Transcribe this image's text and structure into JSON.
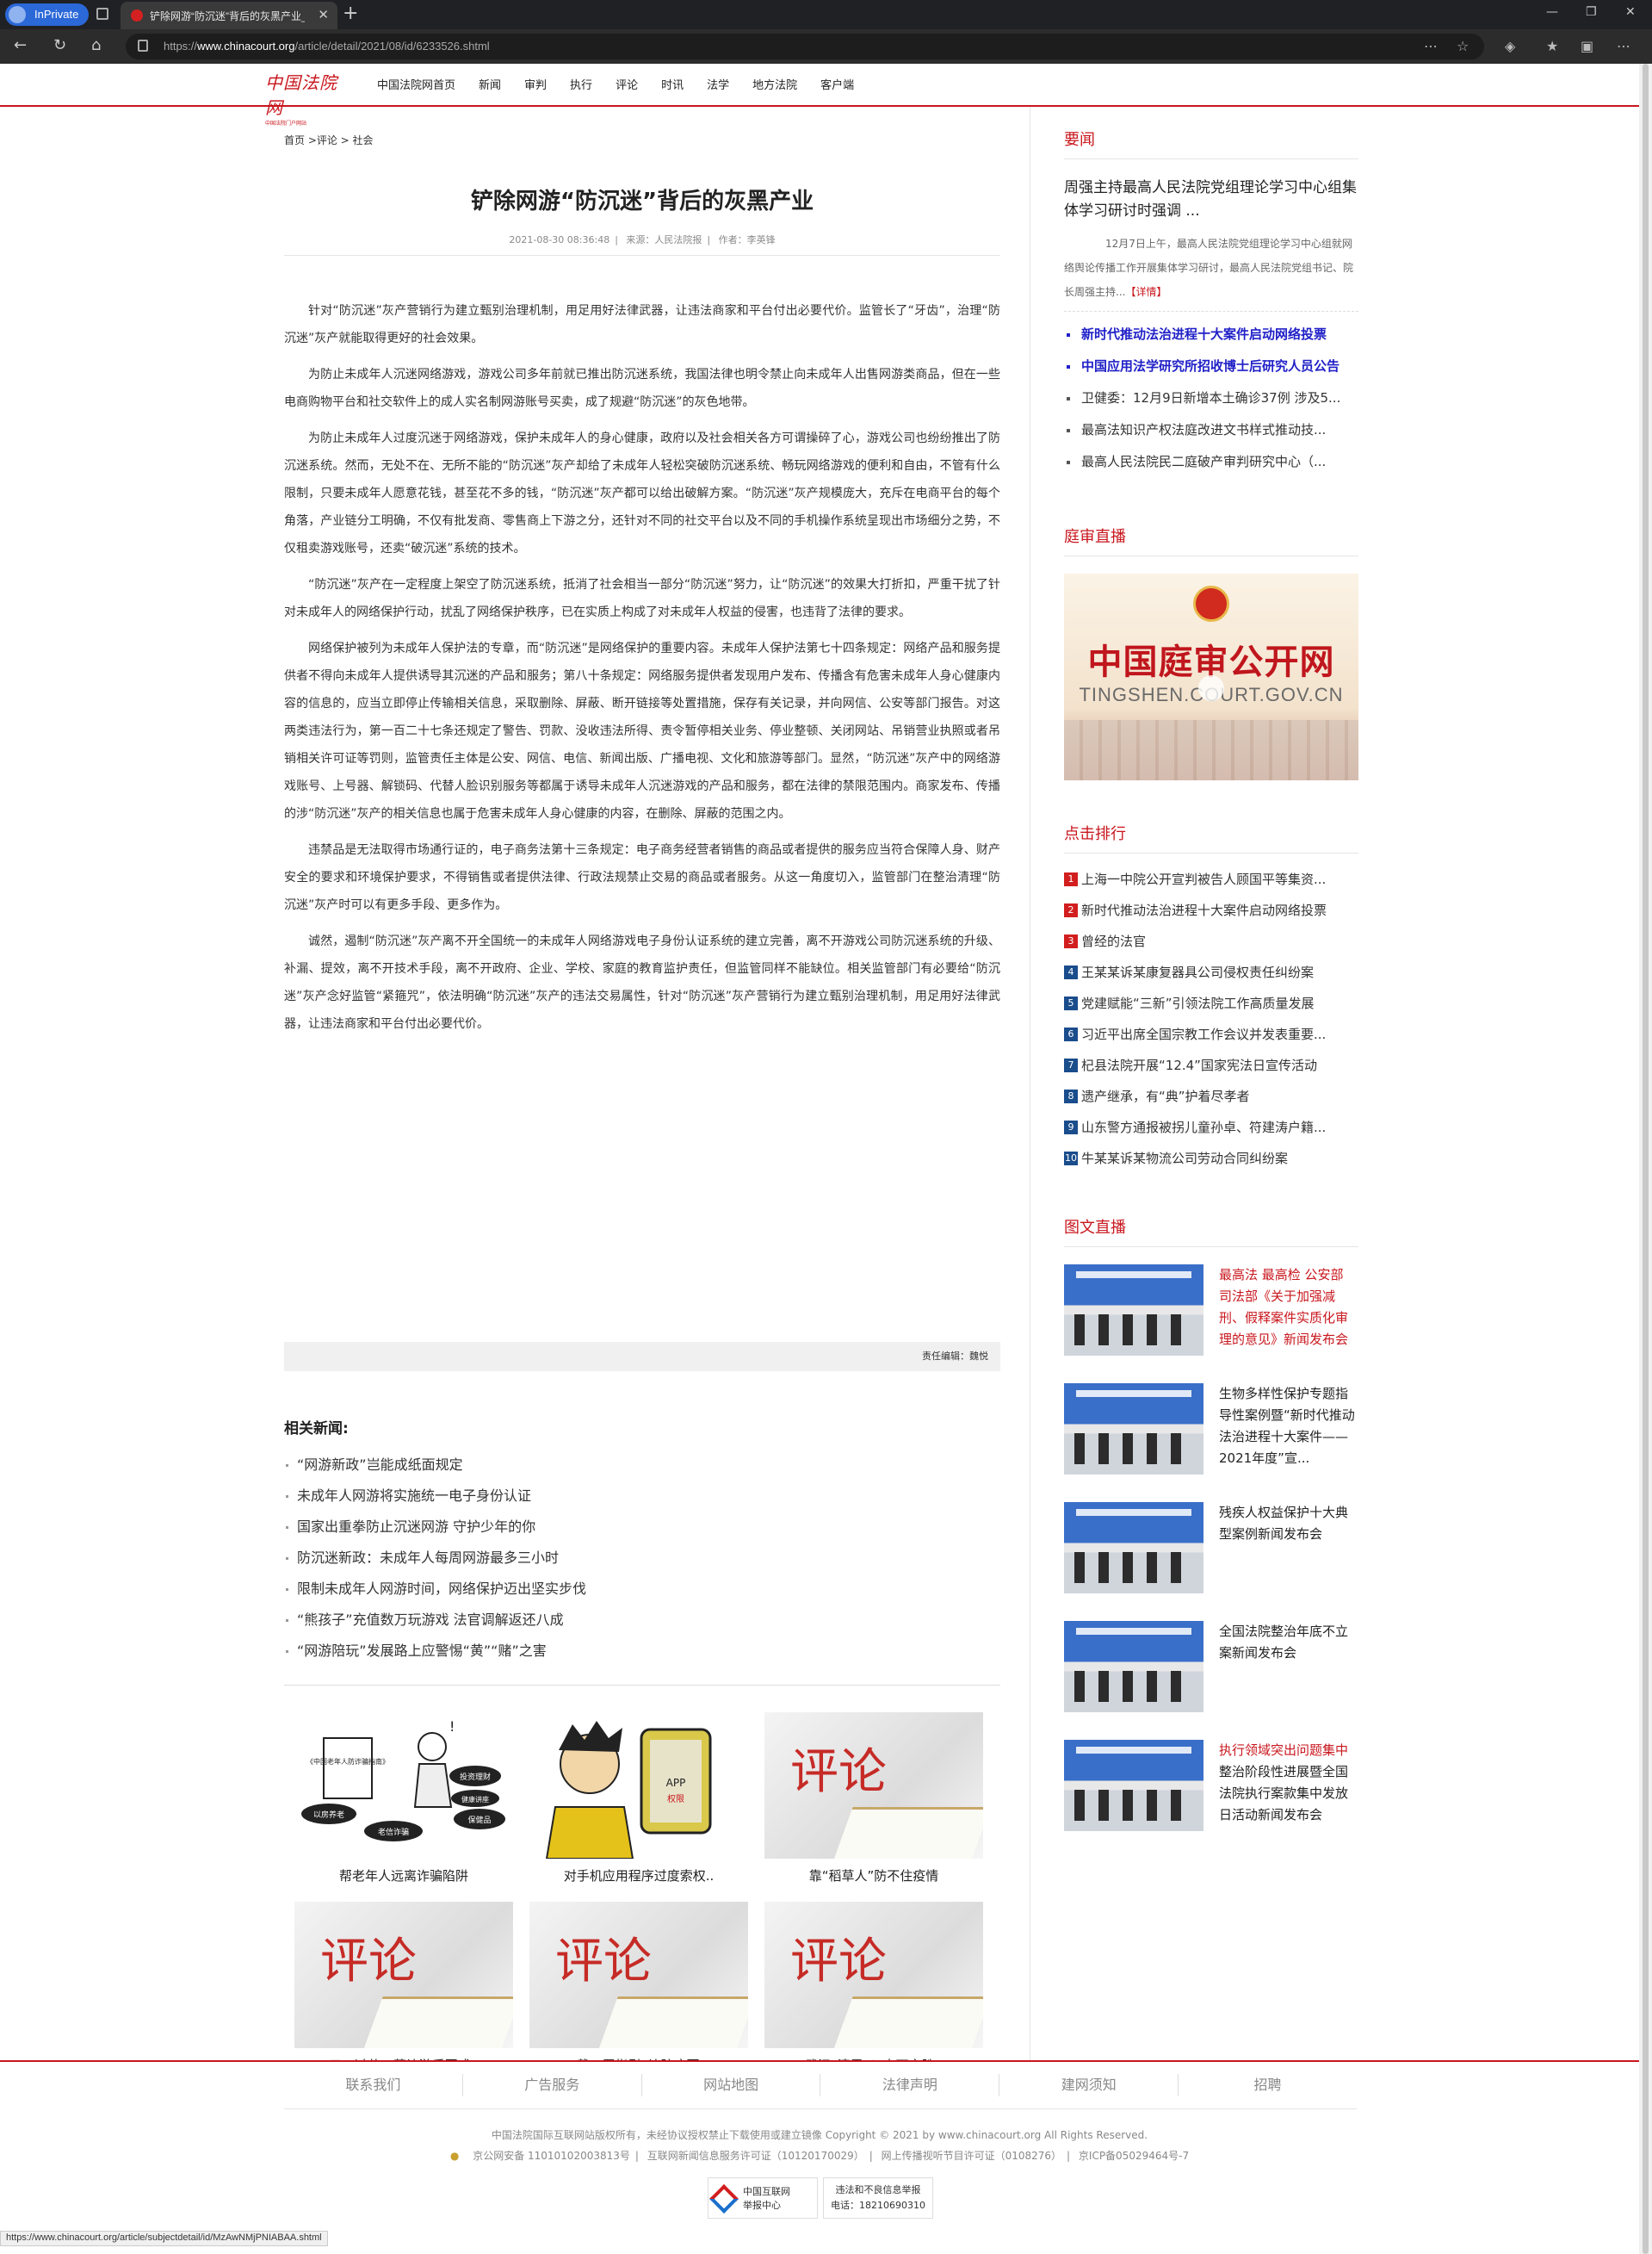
{
  "browser": {
    "inprivate_label": "InPrivate",
    "tab_title": "铲除网游“防沉迷”背后的灰黑产业_",
    "url_prefix": "https://",
    "url_domain": "www.chinacourt.org",
    "url_path": "/article/detail/2021/08/id/6233526.shtml",
    "status_url": "https://www.chinacourt.org/article/subjectdetail/id/MzAwNMjPNIABAA.shtml"
  },
  "header": {
    "logo_text": "中国法院网",
    "logo_sub": "中国法院门户网站",
    "nav": [
      "中国法院网首页",
      "新闻",
      "审判",
      "执行",
      "评论",
      "时讯",
      "法学",
      "地方法院",
      "客户端"
    ]
  },
  "article": {
    "breadcrumb": "首页 >评论 > 社会",
    "title": "铲除网游“防沉迷”背后的灰黑产业",
    "date": "2021-08-30 08:36:48",
    "source": "来源：人民法院报",
    "author": "作者：李英锋",
    "paragraphs": [
      "针对“防沉迷”灰产营销行为建立甄别治理机制，用足用好法律武器，让违法商家和平台付出必要代价。监管长了“牙齿”，治理“防沉迷”灰产就能取得更好的社会效果。",
      "为防止未成年人沉迷网络游戏，游戏公司多年前就已推出防沉迷系统，我国法律也明令禁止向未成年人出售网游类商品，但在一些电商购物平台和社交软件上的成人实名制网游账号买卖，成了规避“防沉迷”的灰色地带。",
      "为防止未成年人过度沉迷于网络游戏，保护未成年人的身心健康，政府以及社会相关各方可谓操碎了心，游戏公司也纷纷推出了防沉迷系统。然而，无处不在、无所不能的“防沉迷”灰产却给了未成年人轻松突破防沉迷系统、畅玩网络游戏的便利和自由，不管有什么限制，只要未成年人愿意花钱，甚至花不多的钱，“防沉迷”灰产都可以给出破解方案。“防沉迷”灰产规模庞大，充斥在电商平台的每个角落，产业链分工明确，不仅有批发商、零售商上下游之分，还针对不同的社交平台以及不同的手机操作系统呈现出市场细分之势，不仅租卖游戏账号，还卖“破沉迷”系统的技术。",
      "“防沉迷”灰产在一定程度上架空了防沉迷系统，抵消了社会相当一部分“防沉迷”努力，让“防沉迷”的效果大打折扣，严重干扰了针对未成年人的网络保护行动，扰乱了网络保护秩序，已在实质上构成了对未成年人权益的侵害，也违背了法律的要求。",
      "网络保护被列为未成年人保护法的专章，而“防沉迷”是网络保护的重要内容。未成年人保护法第七十四条规定：网络产品和服务提供者不得向未成年人提供诱导其沉迷的产品和服务；第八十条规定：网络服务提供者发现用户发布、传播含有危害未成年人身心健康内容的信息的，应当立即停止传输相关信息，采取删除、屏蔽、断开链接等处置措施，保存有关记录，并向网信、公安等部门报告。对这两类违法行为，第一百二十七条还规定了警告、罚款、没收违法所得、责令暂停相关业务、停业整顿、关闭网站、吊销营业执照或者吊销相关许可证等罚则，监管责任主体是公安、网信、电信、新闻出版、广播电视、文化和旅游等部门。显然，“防沉迷”灰产中的网络游戏账号、上号器、解锁码、代替人脸识别服务等都属于诱导未成年人沉迷游戏的产品和服务，都在法律的禁限范围内。商家发布、传播的涉“防沉迷”灰产的相关信息也属于危害未成年人身心健康的内容，在删除、屏蔽的范围之内。",
      "违禁品是无法取得市场通行证的，电子商务法第十三条规定：电子商务经营者销售的商品或者提供的服务应当符合保障人身、财产安全的要求和环境保护要求，不得销售或者提供法律、行政法规禁止交易的商品或者服务。从这一角度切入，监管部门在整治清理“防沉迷”灰产时可以有更多手段、更多作为。",
      "诚然，遏制“防沉迷”灰产离不开全国统一的未成年人网络游戏电子身份认证系统的建立完善，离不开游戏公司防沉迷系统的升级、补漏、提效，离不开技术手段，离不开政府、企业、学校、家庭的教育监护责任，但监管同样不能缺位。相关监管部门有必要给“防沉迷”灰产念好监管“紧箍咒”，依法明确“防沉迷”灰产的违法交易属性，针对“防沉迷”灰产营销行为建立甄别治理机制，用足用好法律武器，让违法商家和平台付出必要代价。"
    ],
    "editor": "责任编辑：魏悦"
  },
  "related": {
    "title": "相关新闻:",
    "items": [
      "“网游新政”岂能成纸面规定",
      "未成年人网游将实施统一电子身份认证",
      "国家出重拳防止沉迷网游 守护少年的你",
      "防沉迷新政：未成年人每周网游最多三小时",
      "限制未成年人网游时间，网络保护迈出坚实步伐",
      "“熊孩子”充值数万玩游戏 法官调解返还八成",
      "“网游陪玩”发展路上应警惕“黄”“赌”之害"
    ]
  },
  "thumbs": [
    {
      "caption": "帮老年人远离诈骗陷阱",
      "image": "cartoon-scam",
      "labels": [
        "《中国老年人防诈骗指南》",
        "以房养老",
        "投资理财",
        "保健品",
        "老信诈骗",
        "健康讲座"
      ]
    },
    {
      "caption": "对手机应用程序过度索权..",
      "image": "cartoon-phone",
      "labels": [
        "APP",
        "权限"
      ]
    },
    {
      "caption": "靠“稻草人”防不住疫情",
      "image": "commentary",
      "word": "评论"
    },
    {
      "caption": "五一过节，莫让游乐园成..",
      "image": "commentary",
      "word": "评论"
    },
    {
      "caption": "“戴口罩指引”让防疫更..",
      "image": "commentary",
      "word": "评论"
    },
    {
      "caption": "武汉“清零”！未可言胜..",
      "image": "commentary",
      "word": "评论"
    }
  ],
  "sidebar": {
    "important_title": "要闻",
    "headline": "周强主持最高人民法院党组理论学习中心组集体学习研讨时强调 ...",
    "headline_summary": "12月7日上午，最高人民法院党组理论学习中心组就网络舆论传播工作开展集体学习研讨，最高人民法院党组书记、院长周强主持...",
    "more_label": "【详情】",
    "news": [
      {
        "text": "新时代推动法治进程十大案件启动网络投票",
        "hot": true
      },
      {
        "text": "中国应用法学研究所招收博士后研究人员公告",
        "hot": true
      },
      {
        "text": "卫健委：12月9日新增本土确诊37例 涉及5...",
        "hot": false
      },
      {
        "text": "最高法知识产权法庭改进文书样式推动技...",
        "hot": false
      },
      {
        "text": "最高人民法院民二庭破产审判研究中心（...",
        "hot": false
      }
    ],
    "live_title": "庭审直播",
    "live_banner_title": "中国庭审公开网",
    "live_banner_url": "TINGSHEN.COURT.GOV.CN",
    "rank_title": "点击排行",
    "rank": [
      "上海一中院公开宣判被告人顾国平等集资...",
      "新时代推动法治进程十大案件启动网络投票",
      "曾经的法官",
      "王某某诉某康复器具公司侵权责任纠纷案",
      "党建赋能“三新”引领法院工作高质量发展",
      "习近平出席全国宗教工作会议并发表重要...",
      "杞县法院开展“12.4”国家宪法日宣传活动",
      "遗产继承，有“典”护着尽孝者",
      "山东警方通报被拐儿童孙卓、符建涛户籍...",
      "牛某某诉某物流公司劳动合同纠纷案"
    ],
    "pic_title": "图文直播",
    "pics": [
      {
        "text": "最高法 最高检 公安部 司法部《关于加强减刑、假释案件实质化审理的意见》新闻发布会",
        "red": true
      },
      {
        "text": "生物多样性保护专题指导性案例暨“新时代推动法治进程十大案件——2021年度”宣...",
        "red": false
      },
      {
        "text": "残疾人权益保护十大典型案例新闻发布会",
        "red": false
      },
      {
        "text": "全国法院整治年底不立案新闻发布会",
        "red": false
      },
      {
        "text_red": "执行领域突出问题集中",
        "text": "整治阶段性进展暨全国法院执行案款集中发放日活动新闻发布会",
        "red": false
      }
    ]
  },
  "footer": {
    "links": [
      "联系我们",
      "广告服务",
      "网站地图",
      "法律声明",
      "建网须知",
      "招聘"
    ],
    "copyright": "中国法院国际互联网站版权所有，未经协议授权禁止下载使用或建立镜像  Copyright © 2021 by www.chinacourt.org All Rights Reserved.",
    "icp": [
      "京公网安备 11010102003813号",
      "互联网新闻信息服务许可证（10120170029）",
      "网上传播视听节目许可证（0108276）",
      "京ICP备05029464号-7"
    ],
    "badge1_line1": "中国互联网",
    "badge1_line2": "举报中心",
    "badge2_line1": "违法和不良信息举报",
    "badge2_line2": "电话：18210690310"
  },
  "colors": {
    "brand_red": "#c9171e",
    "link_blue": "#2020c8",
    "rank_blue": "#1a4d8c"
  }
}
